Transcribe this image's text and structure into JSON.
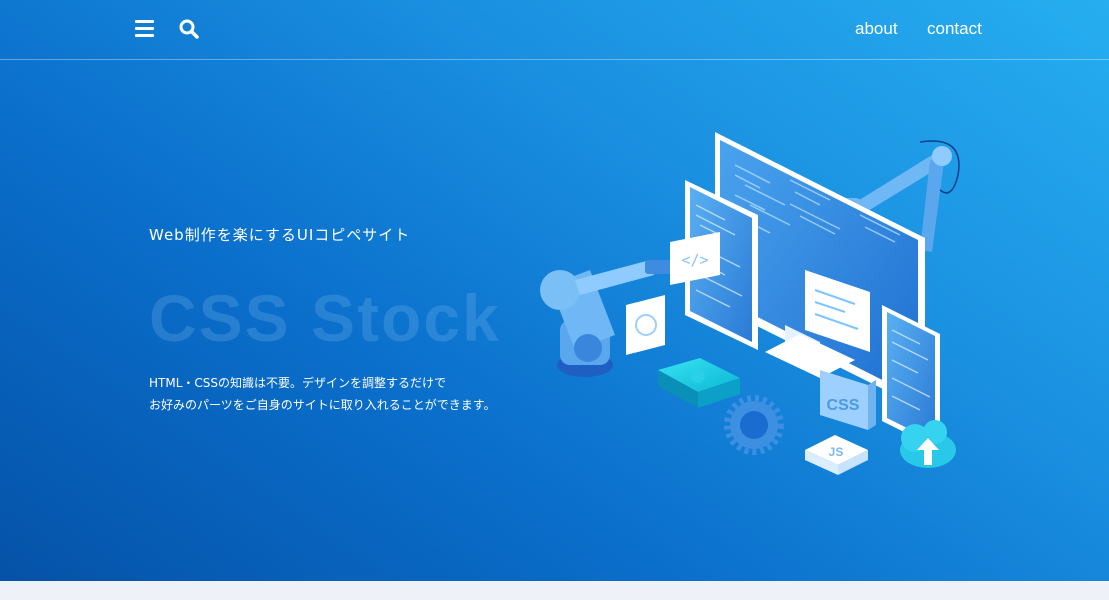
{
  "header": {
    "nav": {
      "about": "about",
      "contact": "contact"
    },
    "icons": [
      "menu-icon",
      "search-icon"
    ]
  },
  "hero": {
    "tagline": "Web制作を楽にするUIコピペサイト",
    "logo": "CSS Stock",
    "description_line1": "HTML・CSSの知識は不要。デザインを調整するだけで",
    "description_line2": "お好みのパーツをご自身のサイトに取り入れることができます。",
    "illustration": {
      "badge_css": "CSS",
      "badge_js": "JS",
      "code_symbol": "</>"
    }
  },
  "colors": {
    "hero_gradient_start": "#0552a8",
    "hero_gradient_end": "#26aef0",
    "text": "#ffffff",
    "background": "#eef2f8"
  }
}
